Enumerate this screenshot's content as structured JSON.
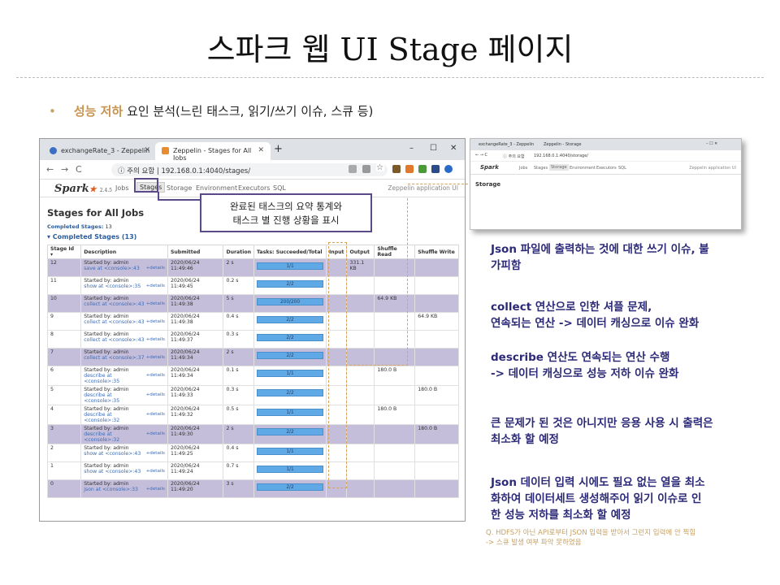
{
  "slide": {
    "title": "스파크 웹 UI Stage 페이지",
    "bullet_highlight": "성능 저하",
    "bullet_rest": " 요인 분석(느린 태스크, 읽기/쓰기 이슈, 스큐 등)"
  },
  "browser": {
    "tab1": "exchangeRate_3 - Zeppelin",
    "tab2": "Zeppelin - Stages for All Jobs",
    "security": "ⓘ 주의 요함",
    "url": "192.168.0.1:4040/stages/",
    "new_tab": "+",
    "win_min": "–",
    "win_max": "☐",
    "win_close": "✕"
  },
  "spark_ui": {
    "logo": "Spark",
    "version": "2.4.5",
    "nav": [
      "Jobs",
      "Stages",
      "Storage",
      "Environment",
      "Executors",
      "SQL"
    ],
    "app_name": "Zeppelin application UI",
    "page_title": "Stages for All Jobs",
    "completed_label": "Completed Stages:",
    "completed_count": "13",
    "completed_header": "▾ Completed Stages (13)",
    "columns": [
      "Stage Id ▾",
      "Description",
      "Submitted",
      "Duration",
      "Tasks: Succeeded/Total",
      "Input",
      "Output",
      "Shuffle Read",
      "Shuffle Write"
    ],
    "details_label": "+details",
    "rows": [
      {
        "id": "12",
        "started": "Started by: admin",
        "desc": "save at <console>:43",
        "submitted": "2020/06/24 11:49:46",
        "duration": "2 s",
        "tasks": "1/1",
        "input": "",
        "output": "331.1 KB",
        "shuffle_read": "",
        "shuffle_write": "",
        "hl": true
      },
      {
        "id": "11",
        "started": "Started by: admin",
        "desc": "show at <console>:35",
        "submitted": "2020/06/24 11:49:45",
        "duration": "0.2 s",
        "tasks": "2/2",
        "input": "",
        "output": "",
        "shuffle_read": "",
        "shuffle_write": "",
        "hl": false
      },
      {
        "id": "10",
        "started": "Started by: admin",
        "desc": "collect at <console>:43",
        "submitted": "2020/06/24 11:49:38",
        "duration": "5 s",
        "tasks": "200/200",
        "input": "",
        "output": "",
        "shuffle_read": "64.9 KB",
        "shuffle_write": "",
        "hl": true
      },
      {
        "id": "9",
        "started": "Started by: admin",
        "desc": "collect at <console>:43",
        "submitted": "2020/06/24 11:49:38",
        "duration": "0.4 s",
        "tasks": "2/2",
        "input": "",
        "output": "",
        "shuffle_read": "",
        "shuffle_write": "64.9 KB",
        "hl": false
      },
      {
        "id": "8",
        "started": "Started by: admin",
        "desc": "collect at <console>:43",
        "submitted": "2020/06/24 11:49:37",
        "duration": "0.3 s",
        "tasks": "2/2",
        "input": "",
        "output": "",
        "shuffle_read": "",
        "shuffle_write": "",
        "hl": false
      },
      {
        "id": "7",
        "started": "Started by: admin",
        "desc": "collect at <console>:37",
        "submitted": "2020/06/24 11:49:34",
        "duration": "2 s",
        "tasks": "2/2",
        "input": "",
        "output": "",
        "shuffle_read": "",
        "shuffle_write": "",
        "hl": true
      },
      {
        "id": "6",
        "started": "Started by: admin",
        "desc": "describe at <console>:35",
        "submitted": "2020/06/24 11:49:34",
        "duration": "0.1 s",
        "tasks": "1/1",
        "input": "",
        "output": "",
        "shuffle_read": "180.0 B",
        "shuffle_write": "",
        "hl": false
      },
      {
        "id": "5",
        "started": "Started by: admin",
        "desc": "describe at <console>:35",
        "submitted": "2020/06/24 11:49:33",
        "duration": "0.3 s",
        "tasks": "2/2",
        "input": "",
        "output": "",
        "shuffle_read": "",
        "shuffle_write": "180.0 B",
        "hl": false
      },
      {
        "id": "4",
        "started": "Started by: admin",
        "desc": "describe at <console>:32",
        "submitted": "2020/06/24 11:49:32",
        "duration": "0.5 s",
        "tasks": "1/1",
        "input": "",
        "output": "",
        "shuffle_read": "180.0 B",
        "shuffle_write": "",
        "hl": false
      },
      {
        "id": "3",
        "started": "Started by: admin",
        "desc": "describe at <console>:32",
        "submitted": "2020/06/24 11:49:30",
        "duration": "2 s",
        "tasks": "2/2",
        "input": "",
        "output": "",
        "shuffle_read": "",
        "shuffle_write": "180.0 B",
        "hl": true
      },
      {
        "id": "2",
        "started": "Started by: admin",
        "desc": "show at <console>:43",
        "submitted": "2020/06/24 11:49:25",
        "duration": "0.4 s",
        "tasks": "1/1",
        "input": "",
        "output": "",
        "shuffle_read": "",
        "shuffle_write": "",
        "hl": false
      },
      {
        "id": "1",
        "started": "Started by: admin",
        "desc": "show at <console>:43",
        "submitted": "2020/06/24 11:49:24",
        "duration": "0.7 s",
        "tasks": "1/1",
        "input": "",
        "output": "",
        "shuffle_read": "",
        "shuffle_write": "",
        "hl": false
      },
      {
        "id": "0",
        "started": "Started by: admin",
        "desc": "json at <console>:33",
        "submitted": "2020/06/24 11:49:20",
        "duration": "3 s",
        "tasks": "2/2",
        "input": "",
        "output": "",
        "shuffle_read": "",
        "shuffle_write": "",
        "hl": true
      }
    ]
  },
  "callout": {
    "line1": "완료된 태스크의 요약 통계와",
    "line2": "태스크 별 진행 상황을 표시"
  },
  "storage": {
    "tab1": "exchangeRate_3 - Zeppelin",
    "tab2": "Zeppelin - Storage",
    "security": "ⓘ 주의 요함",
    "url": "192.168.0.1:4040/storage/",
    "nav": [
      "Jobs",
      "Stages",
      "Storage",
      "Environment",
      "Executors",
      "SQL"
    ],
    "app_name": "Zeppelin application UI",
    "heading": "Storage"
  },
  "notes": [
    {
      "lines": [
        "Json 파일에 출력하는 것에 대한 쓰기 이슈, 불",
        "가피함"
      ]
    },
    {
      "lines": [
        "collect 연산으로 인한 셔플 문제,",
        "연속되는 연산 -> 데이터 캐싱으로 이슈 완화"
      ]
    },
    {
      "lines": [
        "describe 연산도 연속되는 연산 수행",
        "-> 데이터 캐싱으로 성능 저하 이슈 완화"
      ]
    },
    {
      "lines": [
        "큰 문제가 된 것은 아니지만 응용 사용 시 출력은",
        "최소화 할 예정"
      ]
    },
    {
      "lines": [
        "Json 데이터 입력 시에도 필요 없는 열을 최소",
        "화하여 데이터세트 생성해주어 읽기 이슈로 인",
        "한 성능 저하를 최소화 할 예정"
      ]
    }
  ],
  "footnote": {
    "line1": "Q. HDFS가 아닌 API로부터 JSON 입력을 받아서 그런지 입력에 안 찍힘",
    "line2": "-> 스큐 발생 여부 파악 못하였음"
  },
  "colors": {
    "highlight_row": "#c5bedb",
    "note_text": "#2c2a78",
    "accent": "#c8a060",
    "task_bar": "#5ea9e6"
  }
}
